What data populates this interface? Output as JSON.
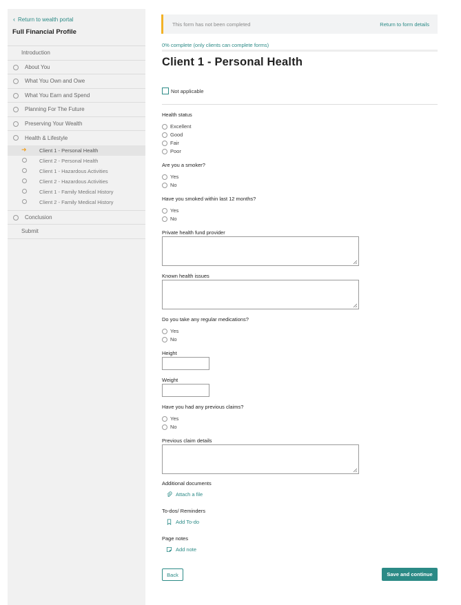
{
  "sidebar": {
    "back_link": "Return to wealth portal",
    "title": "Full Financial Profile",
    "nav": [
      "Introduction",
      "About You",
      "What You Own and Owe",
      "What You Earn and Spend",
      "Planning For The Future",
      "Preserving Your Wealth",
      "Health & Lifestyle"
    ],
    "sub_items": [
      "Client 1 - Personal Health",
      "Client 2 - Personal Health",
      "Client 1 - Hazardous Activities",
      "Client 2 - Hazardous Activities",
      "Client 1 - Family Medical History",
      "Client 2 - Family Medical History"
    ],
    "conclusion": "Conclusion",
    "submit": "Submit"
  },
  "banner": {
    "message": "This form has not been completed",
    "link": "Return to form details"
  },
  "progress": {
    "text": "0% complete (only clients can complete forms)",
    "value": 0
  },
  "form": {
    "title": "Client 1 - Personal Health",
    "not_applicable": "Not applicable",
    "health_status_label": "Health status",
    "health_status_options": [
      "Excellent",
      "Good",
      "Fair",
      "Poor"
    ],
    "smoker_label": "Are you a smoker?",
    "smoked_12_label": "Have you smoked within last 12 months?",
    "fund_label": "Private health fund provider",
    "issues_label": "Known health issues",
    "medications_label": "Do you take any regular medications?",
    "height_label": "Height",
    "weight_label": "Weight",
    "claims_label": "Have you had any previous claims?",
    "claim_details_label": "Previous claim details",
    "yes": "Yes",
    "no": "No",
    "docs_label": "Additional documents",
    "attach_file": "Attach a file",
    "todos_label": "To-dos/ Reminders",
    "add_todo": "Add To-do",
    "notes_label": "Page notes",
    "add_note": "Add note"
  },
  "buttons": {
    "back": "Back",
    "save": "Save and continue"
  },
  "colors": {
    "accent": "#2b8a86",
    "warning": "#f2b227",
    "arrow": "#f0a025"
  }
}
